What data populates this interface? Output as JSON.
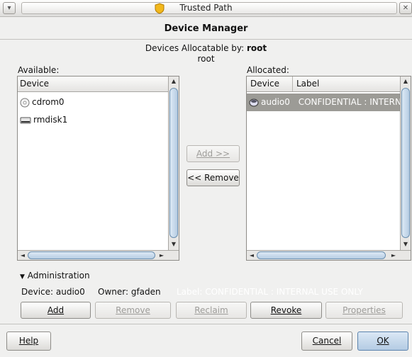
{
  "window": {
    "title": "Trusted Path",
    "menu_glyph": "▾",
    "close_glyph": "✕"
  },
  "header": {
    "title": "Device Manager",
    "allocatable_prefix": "Devices Allocatable by: ",
    "allocatable_user": "root",
    "current_user": "root"
  },
  "available": {
    "label": "Available:",
    "column_device": "Device",
    "items": [
      {
        "name": "cdrom0",
        "icon": "cdrom-icon"
      },
      {
        "name": "rmdisk1",
        "icon": "removable-disk-icon"
      }
    ]
  },
  "allocated": {
    "label": "Allocated:",
    "column_device": "Device",
    "column_label": "Label",
    "items": [
      {
        "name": "audio0",
        "label": "CONFIDENTIAL : INTERNA",
        "icon": "audio-device-icon",
        "selected": true
      }
    ]
  },
  "transfer": {
    "add_label": "Add >>",
    "remove_label": "<< Remove"
  },
  "administration": {
    "expander_label": "Administration",
    "device_text": "Device: audio0",
    "owner_text": "Owner: gfaden",
    "label_text": "Label: CONFIDENTIAL : INTERNAL USE ONLY",
    "buttons": {
      "add": "Add",
      "remove": "Remove",
      "reclaim": "Reclaim",
      "revoke": "Revoke",
      "properties": "Properties"
    }
  },
  "footer": {
    "help": "Help",
    "cancel": "Cancel",
    "ok": "OK"
  },
  "colors": {
    "selection": "#9c9b96",
    "scroll_thumb": "#b7cde3"
  }
}
